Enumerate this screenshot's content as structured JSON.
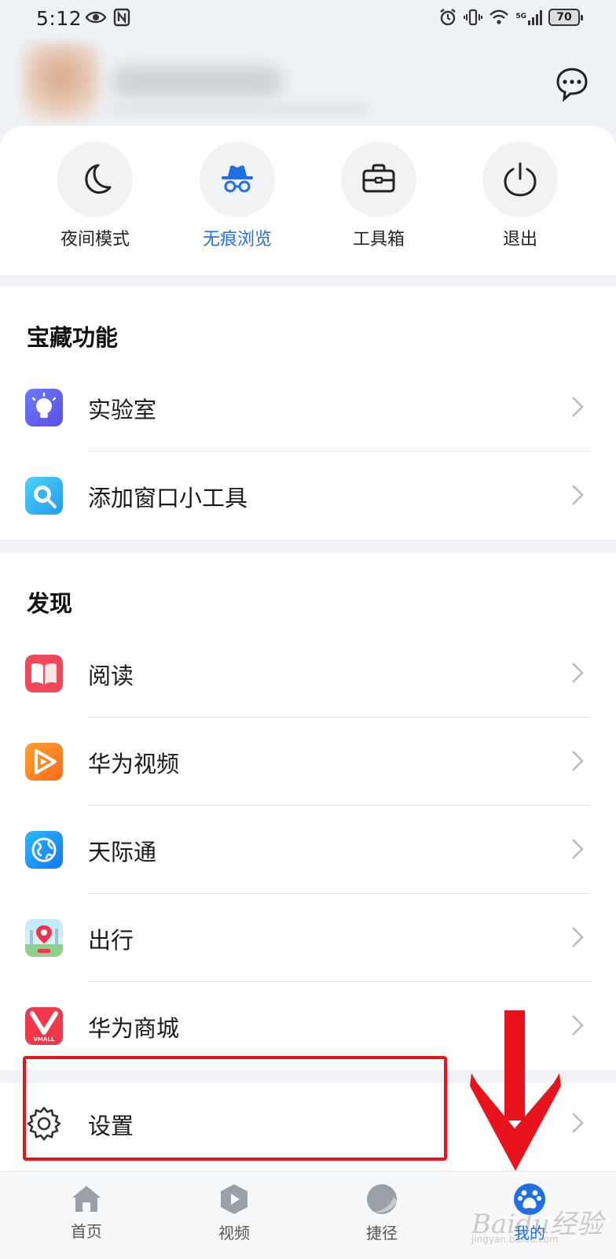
{
  "status_bar": {
    "time": "5:12",
    "battery_level": "70",
    "network_tag": "5G"
  },
  "quick_actions": [
    {
      "label": "夜间模式",
      "icon": "moon-icon",
      "active": false
    },
    {
      "label": "无痕浏览",
      "icon": "incognito-icon",
      "active": true
    },
    {
      "label": "工具箱",
      "icon": "toolbox-icon",
      "active": false
    },
    {
      "label": "退出",
      "icon": "power-icon",
      "active": false
    }
  ],
  "treasure_section": {
    "title": "宝藏功能",
    "items": [
      {
        "label": "实验室",
        "icon": "lightbulb-icon"
      },
      {
        "label": "添加窗口小工具",
        "icon": "magnifier-icon"
      }
    ]
  },
  "discover_section": {
    "title": "发现",
    "items": [
      {
        "label": "阅读",
        "icon": "book-icon"
      },
      {
        "label": "华为视频",
        "icon": "video-play-icon"
      },
      {
        "label": "天际通",
        "icon": "globe-icon"
      },
      {
        "label": "出行",
        "icon": "travel-pin-icon"
      },
      {
        "label": "华为商城",
        "icon": "vmall-icon",
        "icon_text": "VMALL"
      }
    ]
  },
  "settings": {
    "label": "设置",
    "icon": "gear-icon"
  },
  "bottom_nav": [
    {
      "label": "首页",
      "icon": "home-icon",
      "active": false
    },
    {
      "label": "视频",
      "icon": "video-icon",
      "active": false
    },
    {
      "label": "捷径",
      "icon": "shortcut-icon",
      "active": false
    },
    {
      "label": "我的",
      "icon": "profile-paw-icon",
      "active": true
    }
  ],
  "watermark": {
    "logo": "Baidu经验",
    "sub": "jingyan.baidu.com"
  },
  "colors": {
    "accent": "#1f6fe6",
    "annotation_red": "#e8131c",
    "page_bg": "#f0f2f5"
  }
}
